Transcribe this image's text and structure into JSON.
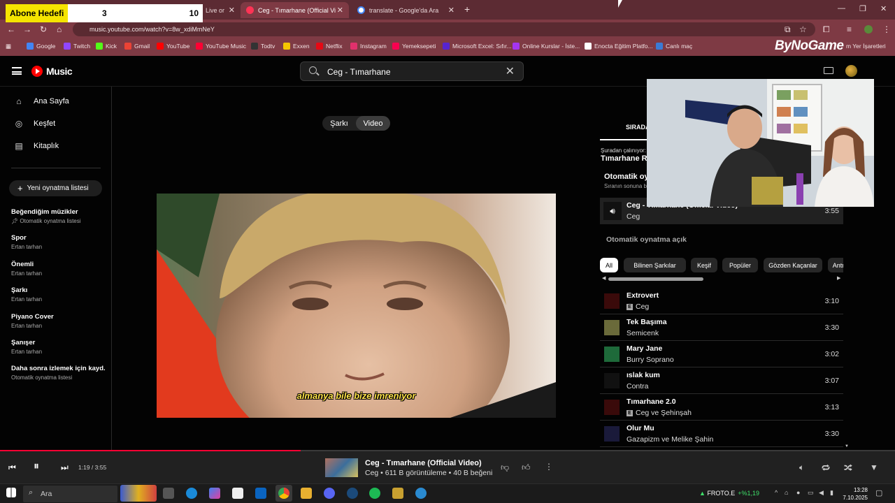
{
  "overlay": {
    "label": "Abone Hedefi",
    "current": "3",
    "goal": "10"
  },
  "browser": {
    "tabs": [
      {
        "label": "Live or",
        "active": false
      },
      {
        "label": "Ceg - Tımarhane (Official Vi",
        "active": true
      },
      {
        "label": "translate - Google'da Ara",
        "active": false
      }
    ],
    "url": "music.youtube.com/watch?v=8w_xdiMmNeY",
    "bookmarks": [
      "Google",
      "Twitch",
      "Kick",
      "Gmail",
      "YouTube",
      "YouTube Music",
      "Todtv",
      "Exxen",
      "Netflix",
      "Instagram",
      "Yemeksepeti",
      "Microsoft Excel: Sıfır...",
      "Online Kurslar - İste...",
      "Enocta Eğitim Platfo...",
      "Canlı maç"
    ],
    "bookmarks_right": "m Yer İşaretleri",
    "sponsor": "ByNoGame"
  },
  "ytm": {
    "logo_text": "Music",
    "search_value": "Ceg - Tımarhane",
    "nav": [
      {
        "label": "Ana Sayfa",
        "icon": "home-icon"
      },
      {
        "label": "Keşfet",
        "icon": "compass-icon"
      },
      {
        "label": "Kitaplık",
        "icon": "library-icon"
      }
    ],
    "new_playlist": "Yeni oynatma listesi",
    "playlists": [
      {
        "title": "Beğendiğim müzikler",
        "sub": "Otomatik oynatma listesi",
        "pin": true
      },
      {
        "title": "Spor",
        "sub": "Ertan tarhan"
      },
      {
        "title": "Önemli",
        "sub": "Ertan tarhan"
      },
      {
        "title": "Şarkı",
        "sub": "Ertan tarhan"
      },
      {
        "title": "Piyano Cover",
        "sub": "Ertan tarhan"
      },
      {
        "title": "Şanışer",
        "sub": "Ertan tarhan"
      },
      {
        "title": "Daha sonra izlemek için kayd...",
        "sub": "Otomatik oynatma listesi"
      }
    ],
    "toggle": {
      "song": "Şarkı",
      "video": "Video",
      "selected": "Video"
    },
    "subtitle": "almanya bile bize imreniyor"
  },
  "queue": {
    "tab_label": "SIRADA",
    "playing_from_label": "Şuradan çalınıyor:",
    "playing_from_name": "Tımarhane Ra",
    "autoplay_heading": "Otomatik oyn",
    "autoplay_sub": "Sıranın sonuna be",
    "current": {
      "title": "Ceg - Tımarhane (Official Video)",
      "artist": "Ceg",
      "duration": "3:55"
    },
    "autoplay_on": "Otomatik oynatma açık",
    "chips": [
      "All",
      "Bilinen Şarkılar",
      "Keşif",
      "Popüler",
      "Gözden Kaçanlar",
      "Antren"
    ],
    "selected_chip": "All",
    "items": [
      {
        "title": "Extrovert",
        "artist": "Ceg",
        "explicit": true,
        "duration": "3:10",
        "thumb": "#3a0a0a"
      },
      {
        "title": "Tek Başıma",
        "artist": "Semicenk",
        "explicit": false,
        "duration": "3:30",
        "thumb": "#6a6a3a"
      },
      {
        "title": "Mary Jane",
        "artist": "Burry Soprano",
        "explicit": false,
        "duration": "3:02",
        "thumb": "#1e6a3a"
      },
      {
        "title": "ıslak kum",
        "artist": "Contra",
        "explicit": false,
        "duration": "3:07",
        "thumb": "#111111"
      },
      {
        "title": "Tımarhane 2.0",
        "artist": "Ceg ve Şehinşah",
        "explicit": true,
        "duration": "3:13",
        "thumb": "#3a0a0a"
      },
      {
        "title": "Olur Mu",
        "artist": "Gazapizm ve Melike Şahin",
        "explicit": false,
        "duration": "3:30",
        "thumb": "#1a1a3a"
      }
    ]
  },
  "player": {
    "time": "1:19 / 3:55",
    "progress": 0.336,
    "title": "Ceg - Tımarhane (Official Video)",
    "subtitle": "Ceg • 611 B görüntüleme • 40 B beğeni"
  },
  "taskbar": {
    "search": "Ara",
    "stock_name": "FROTO.E",
    "stock_change": "+%1,19",
    "time": "13:28",
    "date": "7.10.2025"
  },
  "colors": {
    "accent": "#ff0033",
    "chrome": "#7e3a44",
    "tabbar": "#5c2b33"
  }
}
